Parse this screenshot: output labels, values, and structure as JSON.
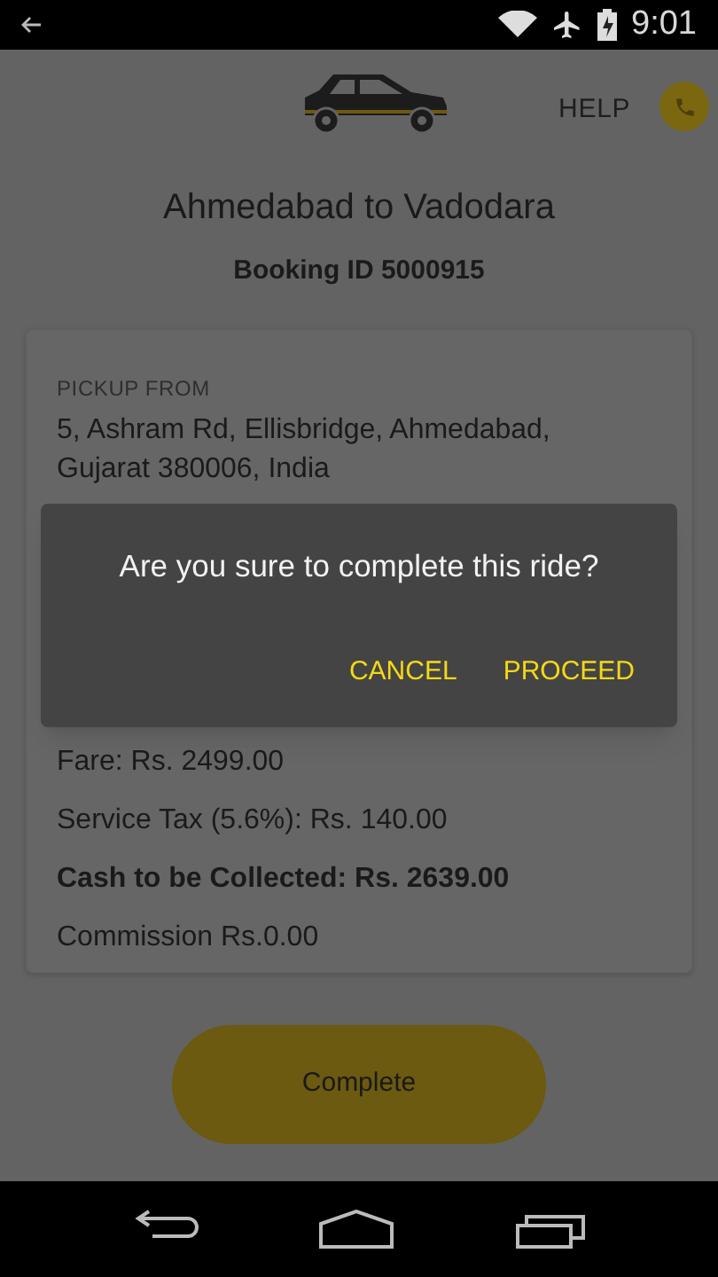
{
  "status_bar": {
    "time": "9:01"
  },
  "header": {
    "help": "HELP"
  },
  "trip": {
    "title": "Ahmedabad to Vadodara",
    "booking_id": "Booking ID 5000915"
  },
  "pickup": {
    "label": "PICKUP FROM",
    "address": "5, Ashram Rd, Ellisbridge, Ahmedabad, Gujarat 380006, India"
  },
  "charges": [
    {
      "text": "Fare: Rs. 2499.00",
      "bold": false
    },
    {
      "text": "Service Tax (5.6%): Rs. 140.00",
      "bold": false
    },
    {
      "text": "Cash to be Collected: Rs. 2639.00",
      "bold": true
    },
    {
      "text": "Commission Rs.0.00",
      "bold": false
    }
  ],
  "complete_button": "Complete",
  "dialog": {
    "message": "Are you sure to complete this ride?",
    "buttons": [
      "CANCEL",
      "PROCEED"
    ]
  }
}
